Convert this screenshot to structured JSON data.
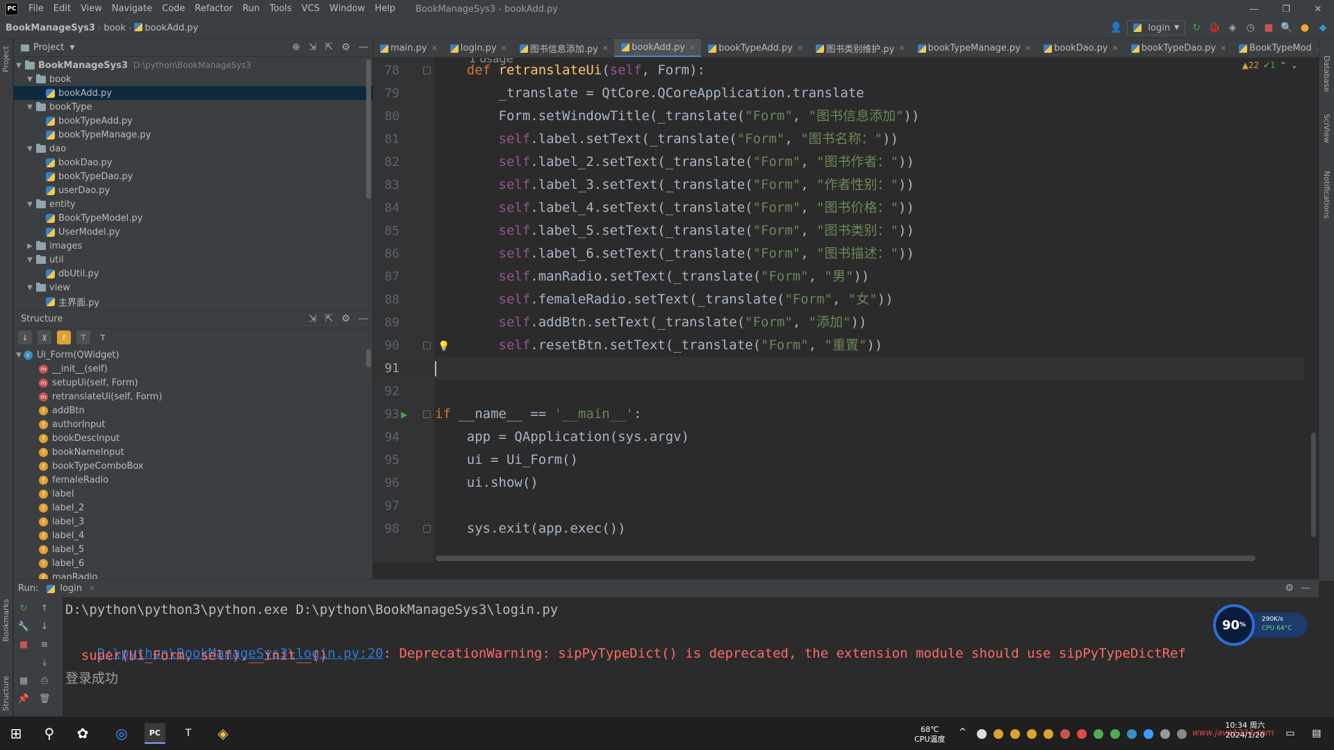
{
  "menubar": {
    "logo": "PC",
    "items": [
      "File",
      "Edit",
      "View",
      "Navigate",
      "Code",
      "Refactor",
      "Run",
      "Tools",
      "VCS",
      "Window",
      "Help"
    ],
    "window_title": "BookManageSys3 - bookAdd.py",
    "controls": [
      "—",
      "❐",
      "✕"
    ]
  },
  "navbar": {
    "project": "BookManageSys3",
    "folder": "book",
    "file": "bookAdd.py",
    "run_config": "login"
  },
  "left_stripe": {
    "project_label": "Project",
    "bookmarks_label": "Bookmarks",
    "structure_label": "Structure"
  },
  "right_stripe": {
    "database_label": "Database",
    "sciview_label": "SciView",
    "notifications_label": "Notifications"
  },
  "project_panel": {
    "title": "Project",
    "root": {
      "name": "BookManageSys3",
      "path": "D:\\python\\BookManageSys3"
    },
    "rows": [
      {
        "label": "book",
        "kind": "folder",
        "indent": 1,
        "open": true
      },
      {
        "label": "bookAdd.py",
        "kind": "file",
        "indent": 2,
        "selected": true
      },
      {
        "label": "bookType",
        "kind": "folder",
        "indent": 1,
        "open": true
      },
      {
        "label": "bookTypeAdd.py",
        "kind": "file",
        "indent": 2
      },
      {
        "label": "bookTypeManage.py",
        "kind": "file",
        "indent": 2
      },
      {
        "label": "dao",
        "kind": "folder",
        "indent": 1,
        "open": true
      },
      {
        "label": "bookDao.py",
        "kind": "file",
        "indent": 2
      },
      {
        "label": "bookTypeDao.py",
        "kind": "file",
        "indent": 2
      },
      {
        "label": "userDao.py",
        "kind": "file",
        "indent": 2
      },
      {
        "label": "entity",
        "kind": "folder",
        "indent": 1,
        "open": true
      },
      {
        "label": "BookTypeModel.py",
        "kind": "file",
        "indent": 2
      },
      {
        "label": "UserModel.py",
        "kind": "file",
        "indent": 2
      },
      {
        "label": "images",
        "kind": "folder",
        "indent": 1,
        "open": false
      },
      {
        "label": "util",
        "kind": "folder",
        "indent": 1,
        "open": true
      },
      {
        "label": "dbUtil.py",
        "kind": "file",
        "indent": 2
      },
      {
        "label": "view",
        "kind": "folder",
        "indent": 1,
        "open": true
      },
      {
        "label": "主界面.py",
        "kind": "file",
        "indent": 2
      }
    ]
  },
  "structure_panel": {
    "title": "Structure",
    "class_name": "Ui_Form(QWidget)",
    "members": [
      {
        "label": "__init__(self)",
        "kind": "m"
      },
      {
        "label": "setupUi(self, Form)",
        "kind": "m"
      },
      {
        "label": "retranslateUi(self, Form)",
        "kind": "m"
      },
      {
        "label": "addBtn",
        "kind": "f"
      },
      {
        "label": "authorInput",
        "kind": "f"
      },
      {
        "label": "bookDescInput",
        "kind": "f"
      },
      {
        "label": "bookNameInput",
        "kind": "f"
      },
      {
        "label": "bookTypeComboBox",
        "kind": "f"
      },
      {
        "label": "femaleRadio",
        "kind": "f"
      },
      {
        "label": "label",
        "kind": "f"
      },
      {
        "label": "label_2",
        "kind": "f"
      },
      {
        "label": "label_3",
        "kind": "f"
      },
      {
        "label": "label_4",
        "kind": "f"
      },
      {
        "label": "label_5",
        "kind": "f"
      },
      {
        "label": "label_6",
        "kind": "f"
      },
      {
        "label": "manRadio",
        "kind": "f"
      }
    ]
  },
  "tabs": [
    {
      "label": "main.py"
    },
    {
      "label": "login.py"
    },
    {
      "label": "图书信息添加.py"
    },
    {
      "label": "bookAdd.py",
      "active": true
    },
    {
      "label": "bookTypeAdd.py"
    },
    {
      "label": "图书类别维护.py"
    },
    {
      "label": "bookTypeManage.py"
    },
    {
      "label": "bookDao.py"
    },
    {
      "label": "bookTypeDao.py"
    },
    {
      "label": "BookTypeMod"
    }
  ],
  "editor": {
    "usage_hint": "1 usage",
    "inspection": {
      "warnings": "▲22",
      "ok": "✔1"
    },
    "current_line": "91",
    "lines": [
      {
        "n": "78",
        "tokens": [
          [
            "",
            "    "
          ],
          [
            "kw",
            "def "
          ],
          [
            "fn",
            "retranslateUi"
          ],
          [
            "",
            "("
          ],
          [
            "self",
            "self"
          ],
          [
            "",
            ", Form):"
          ]
        ]
      },
      {
        "n": "79",
        "tokens": [
          [
            "",
            "        _translate = QtCore.QCoreApplication.translate"
          ]
        ]
      },
      {
        "n": "80",
        "tokens": [
          [
            "",
            "        Form.setWindowTitle(_translate("
          ],
          [
            "str",
            "\"Form\""
          ],
          [
            "",
            ", "
          ],
          [
            "str",
            "\"图书信息添加\""
          ],
          [
            "",
            "))"
          ]
        ]
      },
      {
        "n": "81",
        "tokens": [
          [
            "",
            "        "
          ],
          [
            "self",
            "self"
          ],
          [
            "",
            ".label.setText(_translate("
          ],
          [
            "str",
            "\"Form\""
          ],
          [
            "",
            ", "
          ],
          [
            "str",
            "\"图书名称：\""
          ],
          [
            "",
            "))"
          ]
        ]
      },
      {
        "n": "82",
        "tokens": [
          [
            "",
            "        "
          ],
          [
            "self",
            "self"
          ],
          [
            "",
            ".label_2.setText(_translate("
          ],
          [
            "str",
            "\"Form\""
          ],
          [
            "",
            ", "
          ],
          [
            "str",
            "\"图书作者：\""
          ],
          [
            "",
            "))"
          ]
        ]
      },
      {
        "n": "83",
        "tokens": [
          [
            "",
            "        "
          ],
          [
            "self",
            "self"
          ],
          [
            "",
            ".label_3.setText(_translate("
          ],
          [
            "str",
            "\"Form\""
          ],
          [
            "",
            ", "
          ],
          [
            "str",
            "\"作者性别：\""
          ],
          [
            "",
            "))"
          ]
        ]
      },
      {
        "n": "84",
        "tokens": [
          [
            "",
            "        "
          ],
          [
            "self",
            "self"
          ],
          [
            "",
            ".label_4.setText(_translate("
          ],
          [
            "str",
            "\"Form\""
          ],
          [
            "",
            ", "
          ],
          [
            "str",
            "\"图书价格：\""
          ],
          [
            "",
            "))"
          ]
        ]
      },
      {
        "n": "85",
        "tokens": [
          [
            "",
            "        "
          ],
          [
            "self",
            "self"
          ],
          [
            "",
            ".label_5.setText(_translate("
          ],
          [
            "str",
            "\"Form\""
          ],
          [
            "",
            ", "
          ],
          [
            "str",
            "\"图书类别：\""
          ],
          [
            "",
            "))"
          ]
        ]
      },
      {
        "n": "86",
        "tokens": [
          [
            "",
            "        "
          ],
          [
            "self",
            "self"
          ],
          [
            "",
            ".label_6.setText(_translate("
          ],
          [
            "str",
            "\"Form\""
          ],
          [
            "",
            ", "
          ],
          [
            "str",
            "\"图书描述：\""
          ],
          [
            "",
            "))"
          ]
        ]
      },
      {
        "n": "87",
        "tokens": [
          [
            "",
            "        "
          ],
          [
            "self",
            "self"
          ],
          [
            "",
            ".manRadio.setText(_translate("
          ],
          [
            "str",
            "\"Form\""
          ],
          [
            "",
            ", "
          ],
          [
            "str",
            "\"男\""
          ],
          [
            "",
            "))"
          ]
        ]
      },
      {
        "n": "88",
        "tokens": [
          [
            "",
            "        "
          ],
          [
            "self",
            "self"
          ],
          [
            "",
            ".femaleRadio.setText(_translate("
          ],
          [
            "str",
            "\"Form\""
          ],
          [
            "",
            ", "
          ],
          [
            "str",
            "\"女\""
          ],
          [
            "",
            "))"
          ]
        ]
      },
      {
        "n": "89",
        "tokens": [
          [
            "",
            "        "
          ],
          [
            "self",
            "self"
          ],
          [
            "",
            ".addBtn.setText(_translate("
          ],
          [
            "str",
            "\"Form\""
          ],
          [
            "",
            ", "
          ],
          [
            "str",
            "\"添加\""
          ],
          [
            "",
            "))"
          ]
        ]
      },
      {
        "n": "90",
        "tokens": [
          [
            "",
            "        "
          ],
          [
            "self",
            "self"
          ],
          [
            "",
            ".resetBtn.setText(_translate("
          ],
          [
            "str",
            "\"Form\""
          ],
          [
            "",
            ", "
          ],
          [
            "str",
            "\"重置\""
          ],
          [
            "",
            "))"
          ]
        ]
      },
      {
        "n": "91",
        "tokens": []
      },
      {
        "n": "92",
        "tokens": []
      },
      {
        "n": "93",
        "tokens": [
          [
            "kw",
            "if "
          ],
          [
            "",
            "__name__ == "
          ],
          [
            "str",
            "'__main__'"
          ],
          [
            "",
            ":"
          ]
        ]
      },
      {
        "n": "94",
        "tokens": [
          [
            "",
            "    app = QApplication(sys.argv)"
          ]
        ]
      },
      {
        "n": "95",
        "tokens": [
          [
            "",
            "    ui = Ui_Form()"
          ]
        ]
      },
      {
        "n": "96",
        "tokens": [
          [
            "",
            "    ui.show()"
          ]
        ]
      },
      {
        "n": "97",
        "tokens": []
      },
      {
        "n": "98",
        "tokens": [
          [
            "",
            "    sys.exit(app.exec())"
          ]
        ]
      }
    ]
  },
  "run_panel": {
    "label": "Run:",
    "config_tab": "login",
    "console": {
      "cmd": "D:\\python\\python3\\python.exe D:\\python\\BookManageSys3\\login.py",
      "link": "D:\\python\\BookManageSys3\\login.py:20",
      "warning": ": DeprecationWarning: sipPyTypeDict() is deprecated, the extension module should use sipPyTypeDictRef",
      "super_line": "  super(Ui_Form, self).__init__()",
      "success": "登录成功"
    }
  },
  "net_widget": {
    "value": "90",
    "unit": "%",
    "speed": "290K/s",
    "cpu": "CPU 64°C"
  },
  "taskbar": {
    "temp": "68℃",
    "temp_label": "CPU温度",
    "time": "10:34 周六",
    "date": "2024/1/20",
    "watermark": "www.java1234.com"
  },
  "colors": {
    "keyword": "#cc7832",
    "function": "#ffc66d",
    "string": "#6a8759",
    "self": "#94558d",
    "error": "#ff6b68",
    "link": "#287bde"
  }
}
